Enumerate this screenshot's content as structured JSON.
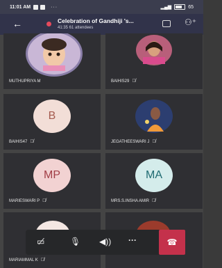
{
  "status_bar": {
    "time": "11:01 AM",
    "dots": "···",
    "battery": "65"
  },
  "header": {
    "title": "Celebration of Gandhiji 's...",
    "subtitle": "41:35  61 attendees"
  },
  "participants": [
    {
      "name": "MUTHUPRIYA M",
      "initials": "",
      "muted": false
    },
    {
      "name": "BAIHIS29",
      "initials": "",
      "muted": true
    },
    {
      "name": "BAIHIS47",
      "initials": "B",
      "muted": true
    },
    {
      "name": "JEGATHEESWARI J",
      "initials": "",
      "muted": true
    },
    {
      "name": "MARIESWARI P",
      "initials": "MP",
      "muted": true
    },
    {
      "name": "MRS.S.INSHA AMIR",
      "initials": "MA",
      "muted": true
    },
    {
      "name": "MARIAMMAL K",
      "initials": "",
      "muted": true
    }
  ],
  "icons": {
    "mute": "muted-mic-icon",
    "camera": "camera-off-icon",
    "mic": "mic-icon",
    "speaker": "speaker-icon",
    "more": "more-icon",
    "end": "end-call-icon"
  },
  "colors": {
    "header_bg": "#31334a",
    "tile_bg": "#2f2f33",
    "end_call": "#c4314b",
    "recording_dot": "#e64a5c"
  }
}
